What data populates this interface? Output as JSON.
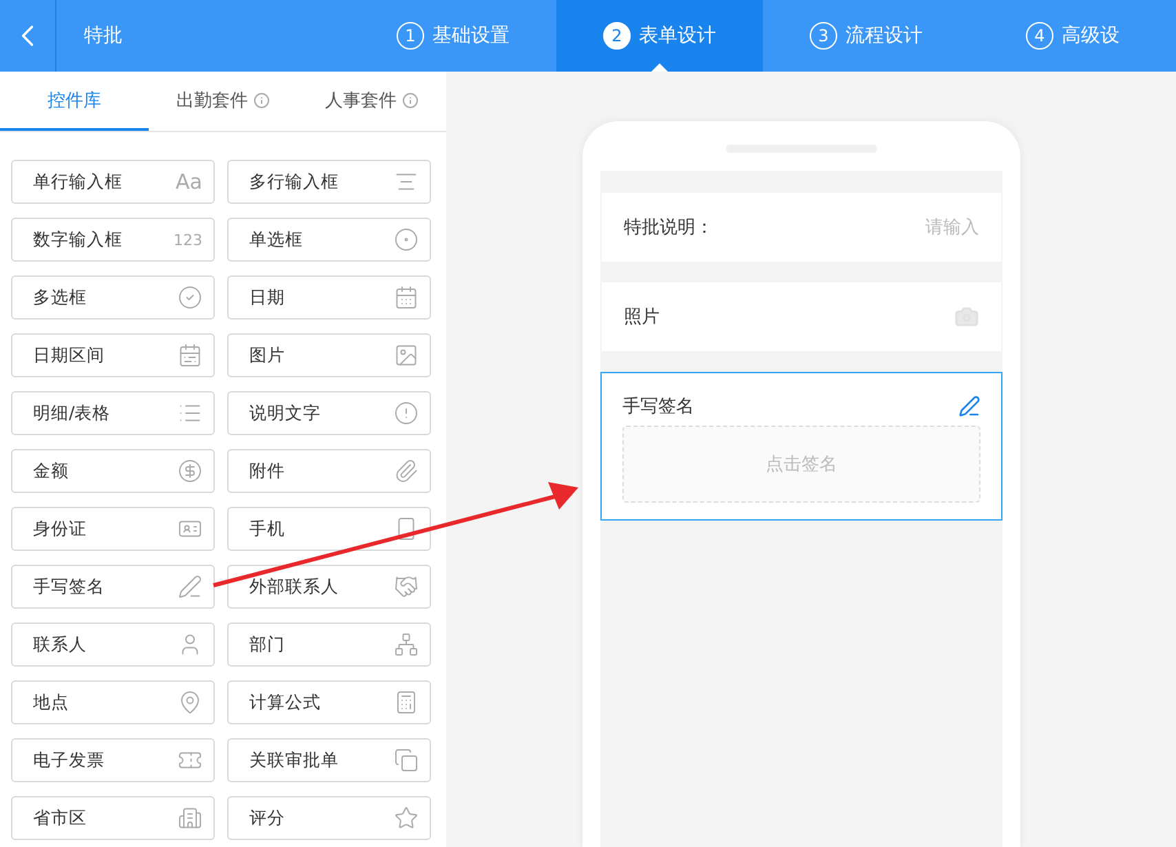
{
  "header": {
    "title": "特批",
    "steps": [
      {
        "number": "1",
        "label": "基础设置",
        "selected": false
      },
      {
        "number": "2",
        "label": "表单设计",
        "selected": true
      },
      {
        "number": "3",
        "label": "流程设计",
        "selected": false
      },
      {
        "number": "4",
        "label": "高级设",
        "selected": false
      }
    ]
  },
  "library": {
    "tabs": [
      {
        "label": "控件库",
        "selected": true,
        "info": false
      },
      {
        "label": "出勤套件",
        "selected": false,
        "info": true
      },
      {
        "label": "人事套件",
        "selected": false,
        "info": true
      }
    ],
    "items": [
      {
        "label": "单行输入框",
        "glyph": "Aa"
      },
      {
        "label": "多行输入框"
      },
      {
        "label": "数字输入框",
        "glyph": "123"
      },
      {
        "label": "单选框"
      },
      {
        "label": "多选框"
      },
      {
        "label": "日期"
      },
      {
        "label": "日期区间"
      },
      {
        "label": "图片"
      },
      {
        "label": "明细/表格"
      },
      {
        "label": "说明文字"
      },
      {
        "label": "金额"
      },
      {
        "label": "附件"
      },
      {
        "label": "身份证"
      },
      {
        "label": "手机"
      },
      {
        "label": "手写签名"
      },
      {
        "label": "外部联系人"
      },
      {
        "label": "联系人"
      },
      {
        "label": "部门"
      },
      {
        "label": "地点"
      },
      {
        "label": "计算公式"
      },
      {
        "label": "电子发票"
      },
      {
        "label": "关联审批单"
      },
      {
        "label": "省市区"
      },
      {
        "label": "评分"
      }
    ]
  },
  "form": {
    "fields": [
      {
        "kind": "text",
        "label": "特批说明：",
        "placeholder": "请输入",
        "selected": false
      },
      {
        "kind": "photo",
        "label": "照片",
        "selected": false
      },
      {
        "kind": "signature",
        "label": "手写签名",
        "pad": "点击签名",
        "selected": true
      }
    ]
  }
}
